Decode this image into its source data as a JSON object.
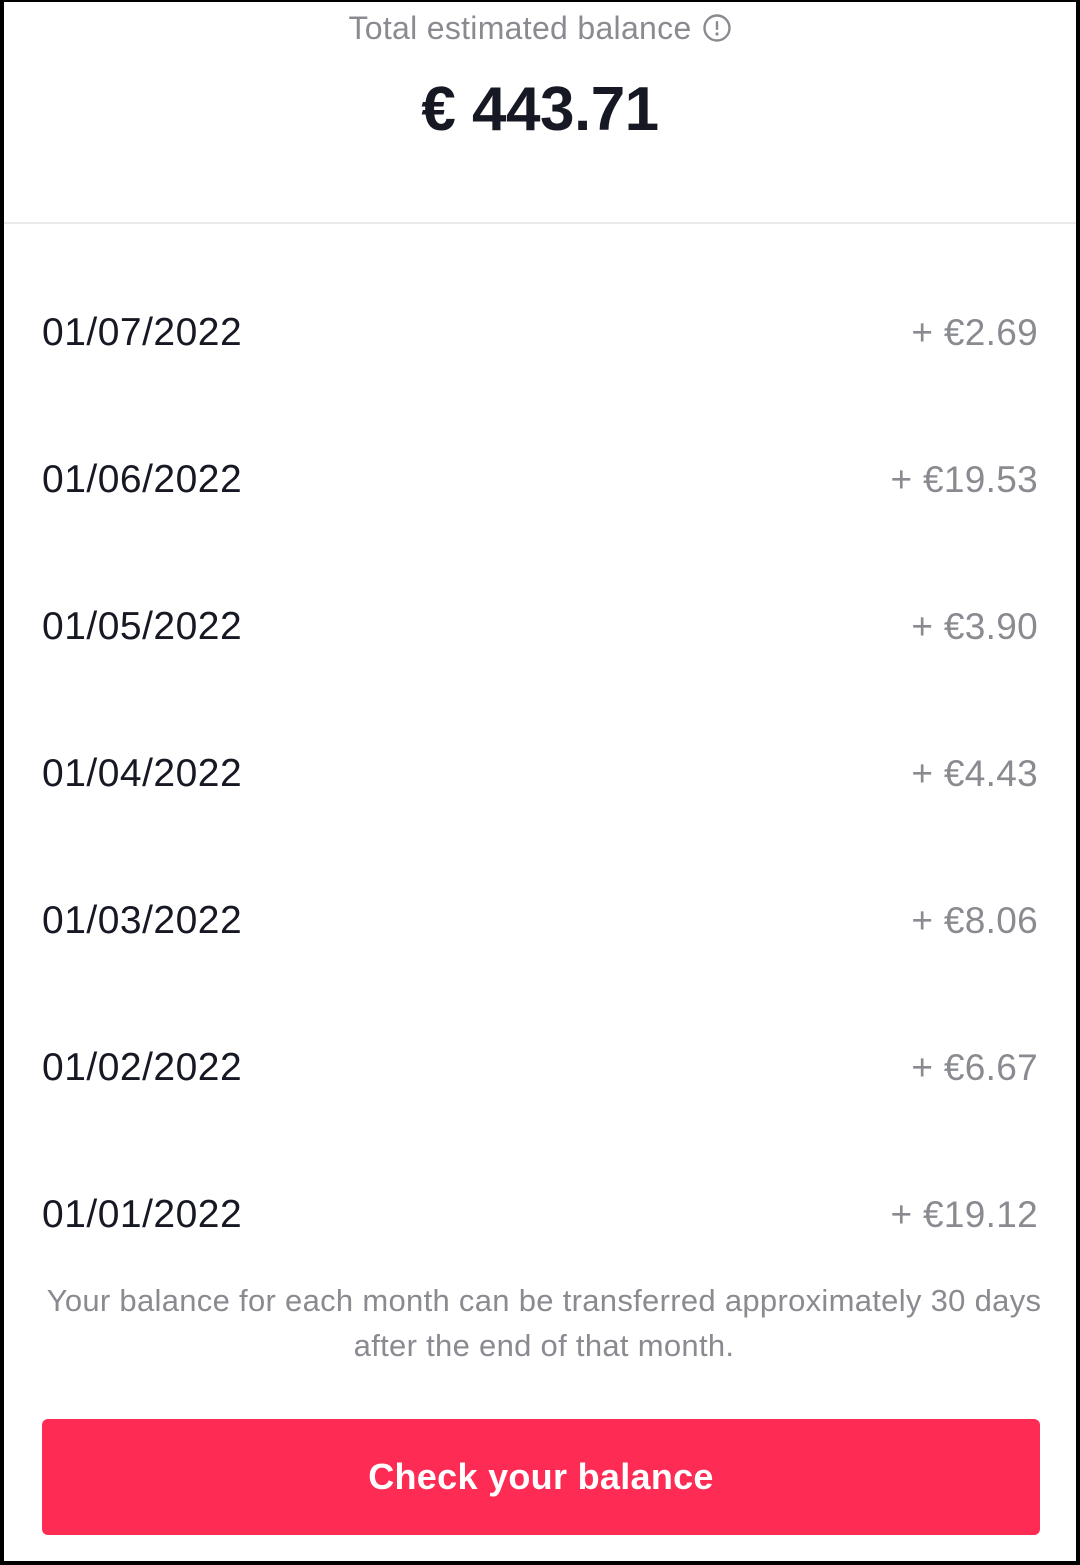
{
  "header": {
    "total_label": "Total estimated balance",
    "info_icon": "info-circle-icon",
    "total_amount": "€ 443.71"
  },
  "monthly_balances": [
    {
      "date": "01/07/2022",
      "amount": "+ €2.69"
    },
    {
      "date": "01/06/2022",
      "amount": "+ €19.53"
    },
    {
      "date": "01/05/2022",
      "amount": "+ €3.90"
    },
    {
      "date": "01/04/2022",
      "amount": "+ €4.43"
    },
    {
      "date": "01/03/2022",
      "amount": "+ €8.06"
    },
    {
      "date": "01/02/2022",
      "amount": "+ €6.67"
    },
    {
      "date": "01/01/2022",
      "amount": "+ €19.12"
    }
  ],
  "note": "Your balance for each month can be transferred approximately 30 days after the end of that month.",
  "cta": {
    "label": "Check your balance"
  },
  "colors": {
    "accent": "#fe2c55",
    "text_primary": "#161823",
    "text_secondary": "#8a8b91",
    "divider": "#e9e9ea"
  }
}
